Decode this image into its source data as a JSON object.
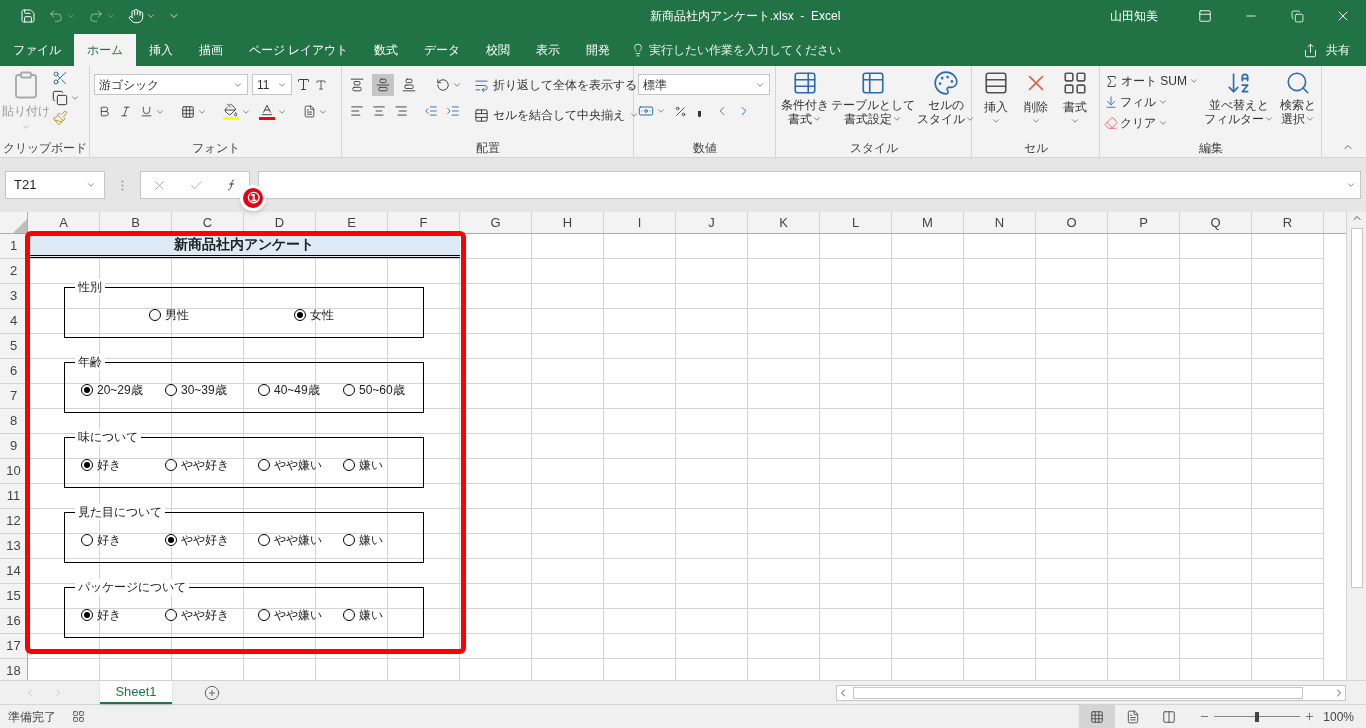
{
  "window": {
    "title": "新商品社内アンケート.xlsx  -  Excel",
    "user": "山田知美"
  },
  "ribbon_tabs": [
    {
      "label": "ファイル",
      "selected": false
    },
    {
      "label": "ホーム",
      "selected": true
    },
    {
      "label": "挿入",
      "selected": false
    },
    {
      "label": "描画",
      "selected": false
    },
    {
      "label": "ページ レイアウト",
      "selected": false
    },
    {
      "label": "数式",
      "selected": false
    },
    {
      "label": "データ",
      "selected": false
    },
    {
      "label": "校閲",
      "selected": false
    },
    {
      "label": "表示",
      "selected": false
    },
    {
      "label": "開発",
      "selected": false
    }
  ],
  "tell_me": {
    "placeholder": "実行したい作業を入力してください"
  },
  "share": "共有",
  "clipboard": {
    "paste": "貼り付け",
    "label": "クリップボード"
  },
  "font": {
    "name": "游ゴシック",
    "size": "11",
    "label": "フォント"
  },
  "alignment": {
    "vertical": [
      {
        "selected": false
      },
      {
        "selected": true
      },
      {
        "selected": false
      }
    ],
    "wrap": "折り返して全体を表示する",
    "merge": "セルを結合して中央揃え",
    "label": "配置"
  },
  "number": {
    "format": "標準",
    "label": "数値"
  },
  "styles": {
    "buttons": [
      {
        "lines": [
          "条件付き",
          "書式"
        ]
      },
      {
        "lines": [
          "テーブルとして",
          "書式設定"
        ]
      },
      {
        "lines": [
          "セルの",
          "スタイル"
        ]
      }
    ],
    "label": "スタイル"
  },
  "cells": {
    "buttons": [
      "挿入",
      "削除",
      "書式"
    ],
    "label": "セル"
  },
  "editing": {
    "autosum": "オート SUM",
    "fill": "フィル",
    "clear": "クリア",
    "buttons": [
      {
        "lines": [
          "並べ替えと",
          "フィルター"
        ]
      },
      {
        "lines": [
          "検索と",
          "選択"
        ]
      }
    ],
    "label": "編集"
  },
  "formula_bar": {
    "name_box": "T21"
  },
  "annotation": "①",
  "sheet": {
    "columns": [
      "A",
      "B",
      "C",
      "D",
      "E",
      "F",
      "G",
      "H",
      "I",
      "J",
      "K",
      "L",
      "M",
      "N",
      "O",
      "P",
      "Q",
      "R"
    ],
    "rows": [
      "1",
      "2",
      "3",
      "4",
      "5",
      "6",
      "7",
      "8",
      "9",
      "10",
      "11",
      "12",
      "13",
      "14",
      "15",
      "16",
      "17",
      "18"
    ],
    "title": "新商品社内アンケート",
    "groups": [
      {
        "label": "性別",
        "options": [
          {
            "label": "男性",
            "selected": false
          },
          {
            "label": "女性",
            "selected": true
          }
        ]
      },
      {
        "label": "年齢",
        "options": [
          {
            "label": "20~29歳",
            "selected": true
          },
          {
            "label": "30~39歳",
            "selected": false
          },
          {
            "label": "40~49歳",
            "selected": false
          },
          {
            "label": "50~60歳",
            "selected": false
          }
        ]
      },
      {
        "label": "味について",
        "options": [
          {
            "label": "好き",
            "selected": true
          },
          {
            "label": "やや好き",
            "selected": false
          },
          {
            "label": "やや嫌い",
            "selected": false
          },
          {
            "label": "嫌い",
            "selected": false
          }
        ]
      },
      {
        "label": "見た目について",
        "options": [
          {
            "label": "好き",
            "selected": false
          },
          {
            "label": "やや好き",
            "selected": true
          },
          {
            "label": "やや嫌い",
            "selected": false
          },
          {
            "label": "嫌い",
            "selected": false
          }
        ]
      },
      {
        "label": "パッケージについて",
        "options": [
          {
            "label": "好き",
            "selected": true
          },
          {
            "label": "やや好き",
            "selected": false
          },
          {
            "label": "やや嫌い",
            "selected": false
          },
          {
            "label": "嫌い",
            "selected": false
          }
        ]
      }
    ]
  },
  "sheet_tabs": [
    {
      "label": "Sheet1",
      "selected": true
    }
  ],
  "status_bar": {
    "status": "準備完了",
    "views": [
      {
        "selected": true
      },
      {
        "selected": false
      },
      {
        "selected": false
      }
    ],
    "zoom": {
      "level": 0.5,
      "reading": "100%"
    }
  }
}
